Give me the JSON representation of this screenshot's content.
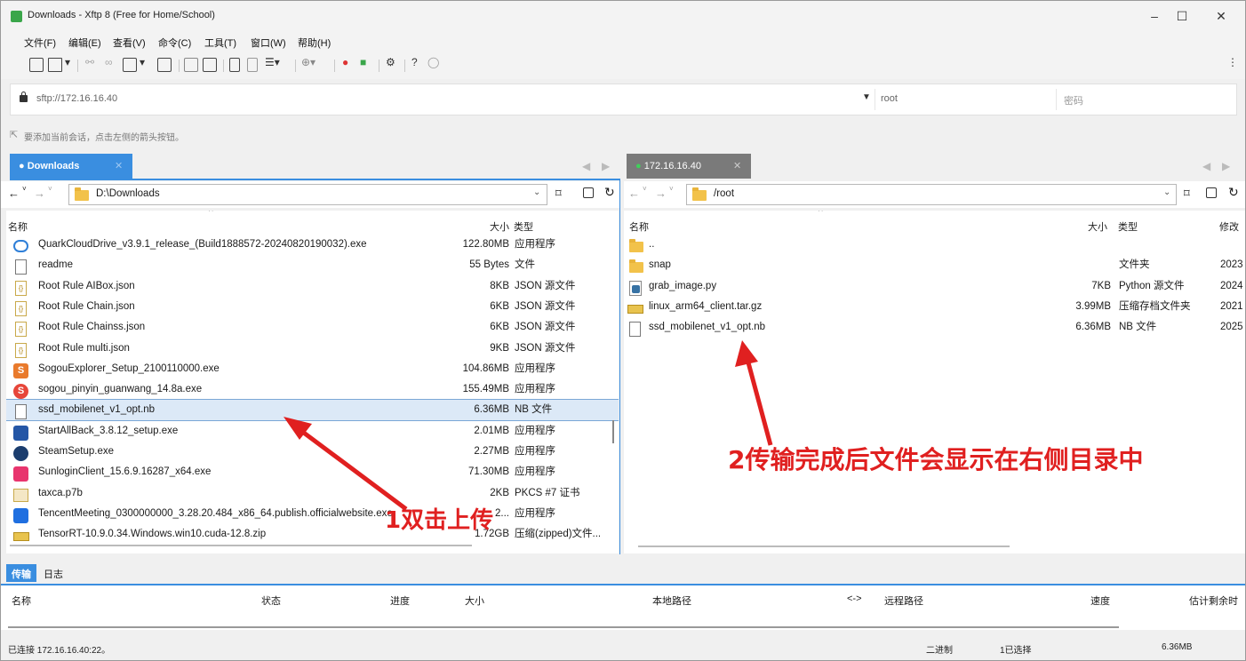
{
  "window": {
    "title": "Downloads - Xftp 8 (Free for Home/School)",
    "minimize": "–",
    "maximize": "☐",
    "close": "✕"
  },
  "menu": [
    "文件(F)",
    "编辑(E)",
    "查看(V)",
    "命令(C)",
    "工具(T)",
    "窗口(W)",
    "帮助(H)"
  ],
  "address": {
    "url": "sftp://172.16.16.40",
    "user": "root",
    "password_placeholder": "密码"
  },
  "hint": "要添加当前会话，点击左侧的箭头按钮。",
  "left": {
    "tab": "Downloads",
    "path": "D:\\Downloads",
    "headers": {
      "name": "名称",
      "size": "大小",
      "type": "类型"
    },
    "files": [
      {
        "name": "QuarkCloudDrive_v3.9.1_release_(Build1888572-20240820190032).exe",
        "size": "122.80MB",
        "type": "应用程序",
        "icon": "quark-icon"
      },
      {
        "name": "readme",
        "size": "55 Bytes",
        "type": "文件",
        "icon": "file-icon"
      },
      {
        "name": "Root Rule AIBox.json",
        "size": "8KB",
        "type": "JSON 源文件",
        "icon": "json-icon"
      },
      {
        "name": "Root Rule Chain.json",
        "size": "6KB",
        "type": "JSON 源文件",
        "icon": "json-icon"
      },
      {
        "name": "Root Rule Chainss.json",
        "size": "6KB",
        "type": "JSON 源文件",
        "icon": "json-icon"
      },
      {
        "name": "Root Rule multi.json",
        "size": "9KB",
        "type": "JSON 源文件",
        "icon": "json-icon"
      },
      {
        "name": "SogouExplorer_Setup_2100110000.exe",
        "size": "104.86MB",
        "type": "应用程序",
        "icon": "sogou-explorer-icon"
      },
      {
        "name": "sogou_pinyin_guanwang_14.8a.exe",
        "size": "155.49MB",
        "type": "应用程序",
        "icon": "sogou-pinyin-icon"
      },
      {
        "name": "ssd_mobilenet_v1_opt.nb",
        "size": "6.36MB",
        "type": "NB 文件",
        "icon": "file-icon"
      },
      {
        "name": "StartAllBack_3.8.12_setup.exe",
        "size": "2.01MB",
        "type": "应用程序",
        "icon": "startallback-icon"
      },
      {
        "name": "SteamSetup.exe",
        "size": "2.27MB",
        "type": "应用程序",
        "icon": "steam-icon"
      },
      {
        "name": "SunloginClient_15.6.9.16287_x64.exe",
        "size": "71.30MB",
        "type": "应用程序",
        "icon": "sunlogin-icon"
      },
      {
        "name": "taxca.p7b",
        "size": "2KB",
        "type": "PKCS #7 证书",
        "icon": "certificate-icon"
      },
      {
        "name": "TencentMeeting_0300000000_3.28.20.484_x86_64.publish.officialwebsite.exe",
        "size": "2...",
        "type": "应用程序",
        "icon": "tencent-meeting-icon"
      },
      {
        "name": "TensorRT-10.9.0.34.Windows.win10.cuda-12.8.zip",
        "size": "1.72GB",
        "type": "压缩(zipped)文件...",
        "icon": "zip-icon"
      }
    ]
  },
  "right": {
    "tab": "172.16.16.40",
    "path": "/root",
    "headers": {
      "name": "名称",
      "size": "大小",
      "type": "类型",
      "modified": "修改"
    },
    "files": [
      {
        "name": "..",
        "size": "",
        "type": "",
        "date": "",
        "icon": "folder-icon"
      },
      {
        "name": "snap",
        "size": "",
        "type": "文件夹",
        "date": "2023",
        "icon": "folder-icon"
      },
      {
        "name": "grab_image.py",
        "size": "7KB",
        "type": "Python 源文件",
        "date": "2024",
        "icon": "python-icon"
      },
      {
        "name": "linux_arm64_client.tar.gz",
        "size": "3.99MB",
        "type": "压缩存档文件夹",
        "date": "2021",
        "icon": "archive-icon"
      },
      {
        "name": "ssd_mobilenet_v1_opt.nb",
        "size": "6.36MB",
        "type": "NB 文件",
        "date": "2025",
        "icon": "file-icon"
      }
    ]
  },
  "log": {
    "tabs": [
      "传输",
      "日志"
    ],
    "headers": [
      "名称",
      "状态",
      "进度",
      "大小",
      "本地路径",
      "<->",
      "远程路径",
      "速度",
      "估计剩余时"
    ]
  },
  "status": {
    "connection": "已连接 172.16.16.40:22。",
    "mode": "二进制",
    "selected": "1已选择",
    "size": "6.36MB"
  },
  "annotations": {
    "step1": "1双击上传",
    "step2": "2传输完成后文件会显示在右侧目录中"
  },
  "colors": {
    "tab_active": "#3a8ee0",
    "tab_remote": "#7a7a7a",
    "annotation": "#e02020"
  }
}
